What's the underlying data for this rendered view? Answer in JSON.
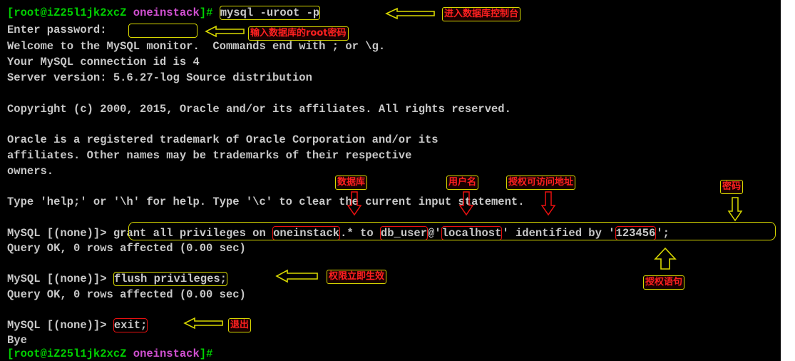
{
  "terminal": {
    "prompt_open": "[",
    "prompt_user_host": "root@iZ25l1jk2xcZ",
    "prompt_dir": "oneinstack",
    "prompt_close": "]#",
    "cmd_login": "mysql -uroot -p",
    "password_label": "Enter password:",
    "welcome": "Welcome to the MySQL monitor.  Commands end with ; or \\g.",
    "connection_id": "Your MySQL connection id is 4",
    "server_version": "Server version: 5.6.27-log Source distribution",
    "copyright": "Copyright (c) 2000, 2015, Oracle and/or its affiliates. All rights reserved.",
    "trademark_1": "Oracle is a registered trademark of Oracle Corporation and/or its",
    "trademark_2": "affiliates. Other names may be trademarks of their respective",
    "trademark_3": "owners.",
    "help_text": "Type 'help;' or '\\h' for help. Type '\\c' to clear the current input statement.",
    "mysql_prompt": "MySQL [(none)]>",
    "grant": {
      "part1": "grant all privileges on ",
      "database": "oneinstack",
      "part2": ".* to ",
      "user": "db_user",
      "part3": "@'",
      "host": "localhost",
      "part4": "' identified by '",
      "password": "123456",
      "part5": "';"
    },
    "query_ok": "Query OK, 0 rows affected (0.00 sec)",
    "cmd_flush": "flush privileges;",
    "cmd_exit": "exit;",
    "bye": "Bye"
  },
  "annotations": {
    "enter_console": "进入数据库控制台",
    "enter_root_password": "输入数据库的root密码",
    "database": "数据库",
    "username": "用户名",
    "authorized_host": "授权可访问地址",
    "password": "密码",
    "grant_statement": "授权语句",
    "privileges_effective": "权限立即生效",
    "exit": "退出"
  },
  "colors": {
    "terminal_bg": "#000000",
    "text": "#c8c8c8",
    "prompt_green": "#00d000",
    "prompt_magenta": "#d04fd0",
    "annotation_red": "#ff2020",
    "highlight_yellow": "#d8d800"
  },
  "icons": [
    "arrow-left-icon",
    "arrow-down-icon",
    "arrow-up-icon"
  ]
}
